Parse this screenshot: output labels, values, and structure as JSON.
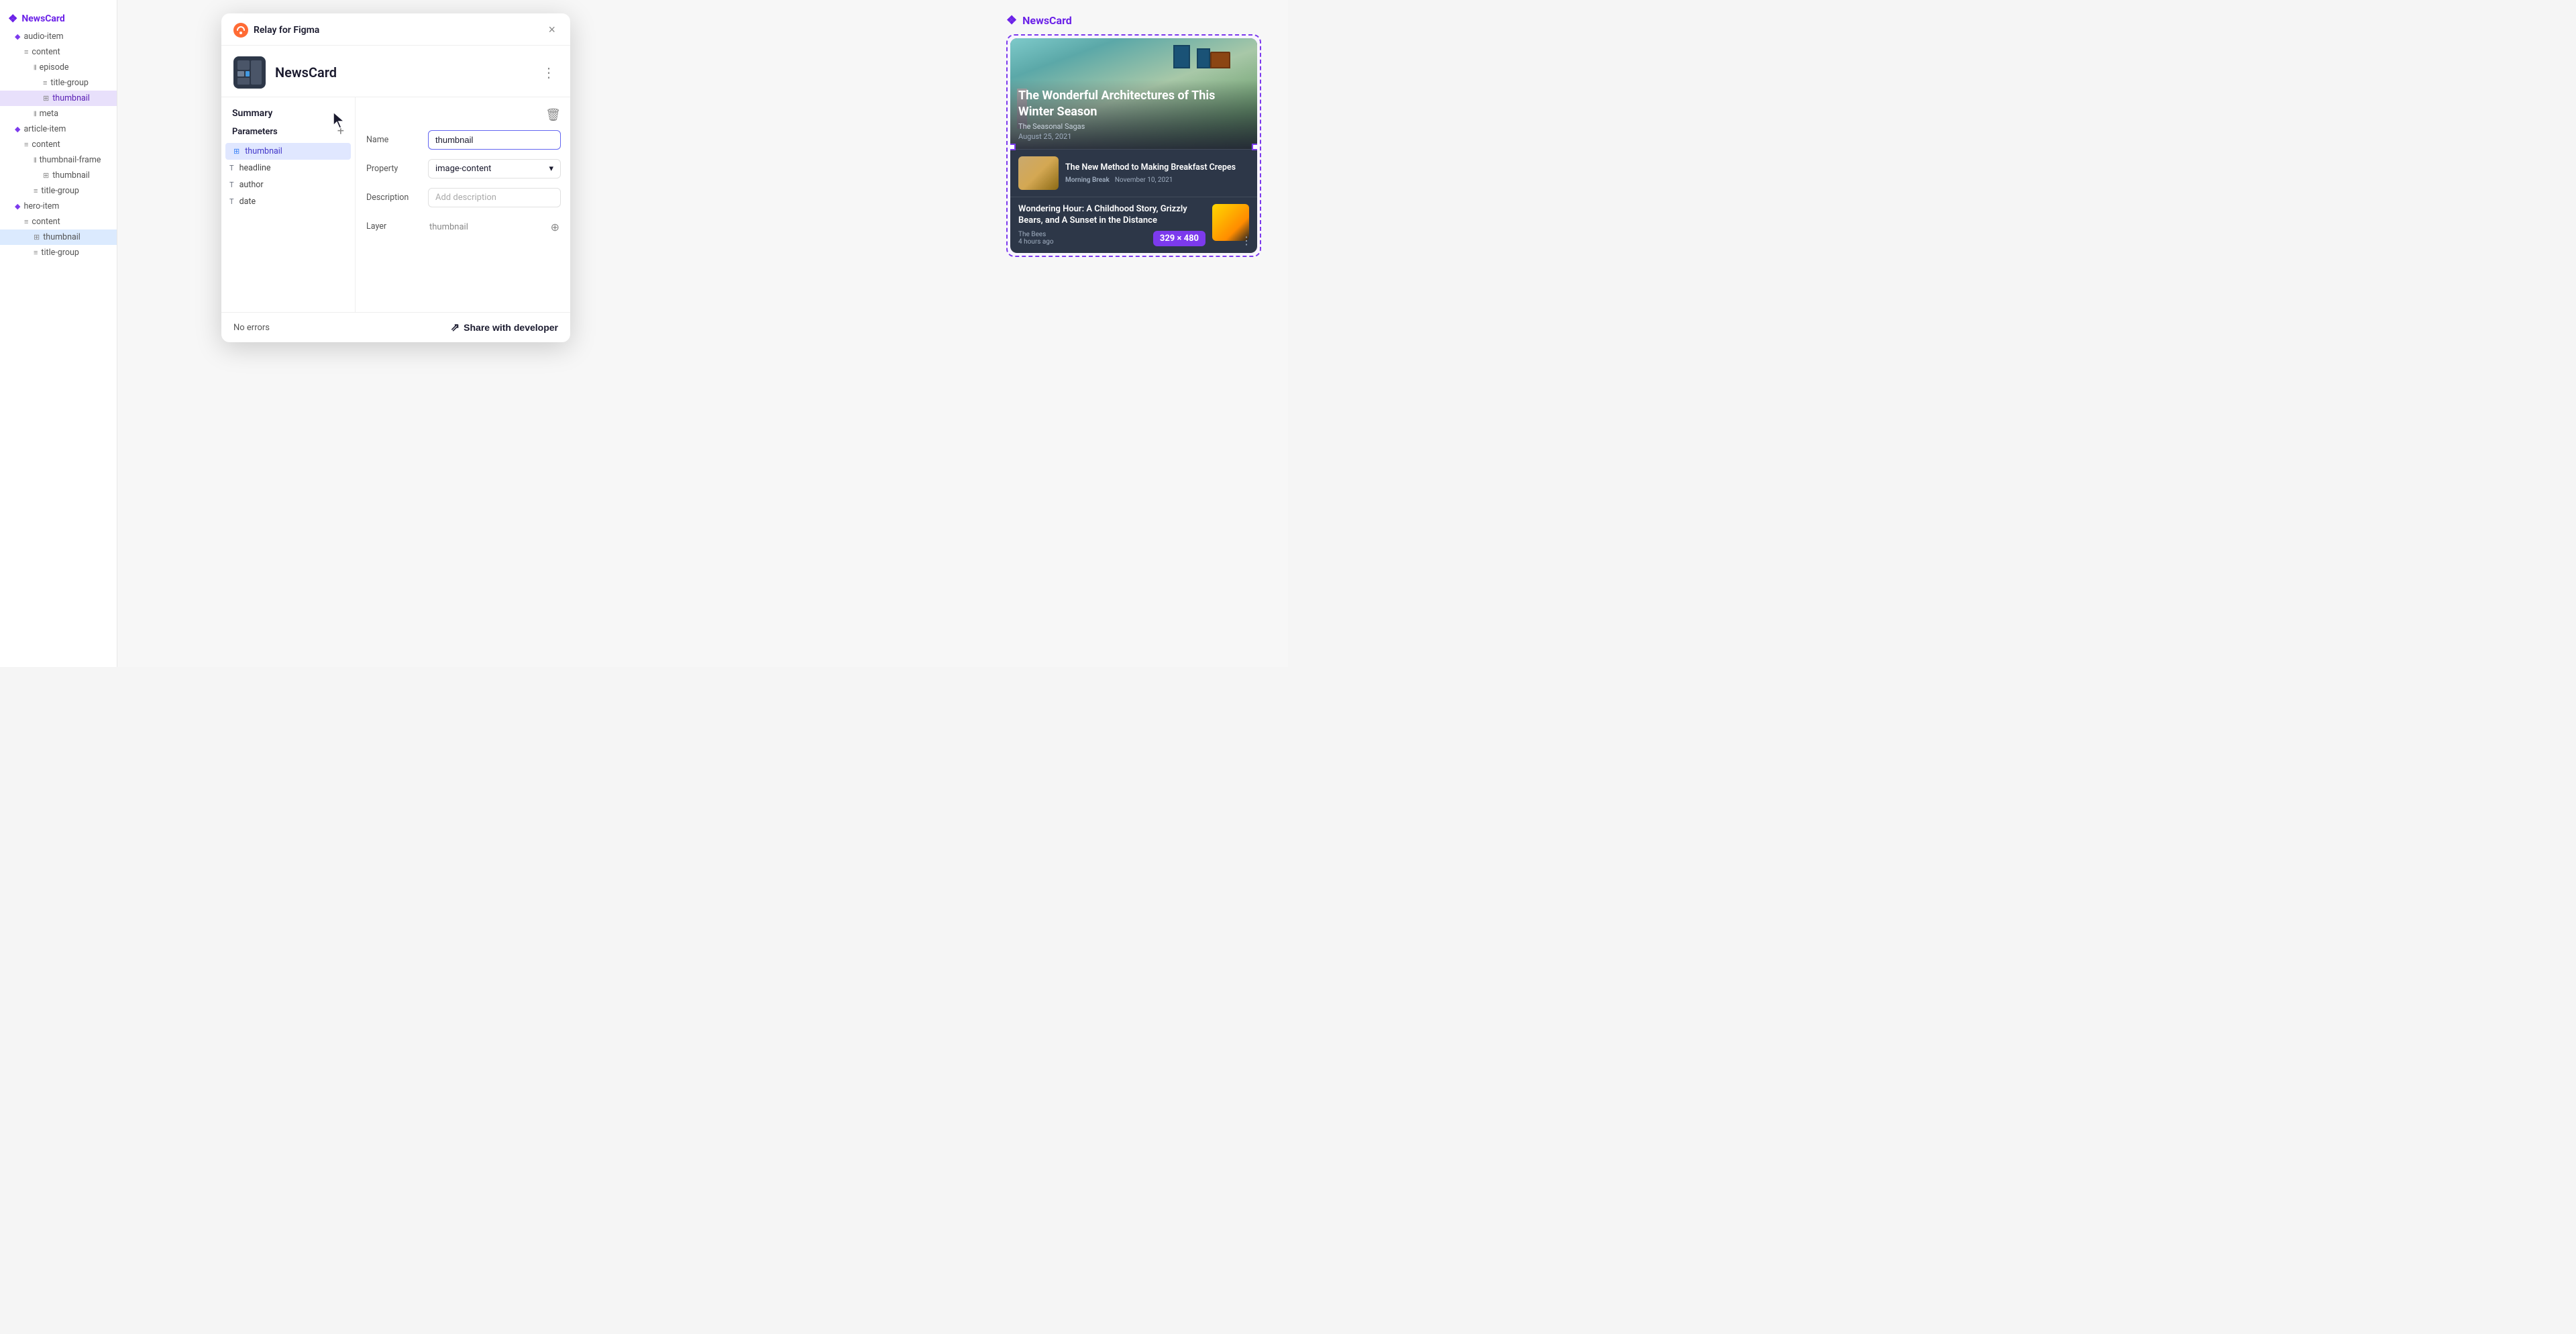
{
  "app": {
    "title": "NewsCard"
  },
  "sidebar": {
    "root_label": "NewsCard",
    "items": [
      {
        "id": "audio-item",
        "label": "audio-item",
        "indent": 1,
        "icon": "diamond",
        "color": "purple"
      },
      {
        "id": "content",
        "label": "content",
        "indent": 2,
        "icon": "lines"
      },
      {
        "id": "episode",
        "label": "episode",
        "indent": 3,
        "icon": "bars"
      },
      {
        "id": "title-group",
        "label": "title-group",
        "indent": 4,
        "icon": "lines"
      },
      {
        "id": "thumbnail-1",
        "label": "thumbnail",
        "indent": 4,
        "icon": "img",
        "selected": true
      },
      {
        "id": "meta",
        "label": "meta",
        "indent": 3,
        "icon": "bars"
      },
      {
        "id": "article-item",
        "label": "article-item",
        "indent": 1,
        "icon": "diamond",
        "color": "purple"
      },
      {
        "id": "content-2",
        "label": "content",
        "indent": 2,
        "icon": "lines"
      },
      {
        "id": "thumbnail-frame",
        "label": "thumbnail-frame",
        "indent": 3,
        "icon": "bars"
      },
      {
        "id": "thumbnail-2",
        "label": "thumbnail",
        "indent": 4,
        "icon": "img"
      },
      {
        "id": "title-group-2",
        "label": "title-group",
        "indent": 3,
        "icon": "lines"
      },
      {
        "id": "hero-item",
        "label": "hero-item",
        "indent": 1,
        "icon": "diamond",
        "color": "purple"
      },
      {
        "id": "content-3",
        "label": "content",
        "indent": 2,
        "icon": "lines"
      },
      {
        "id": "thumbnail-3",
        "label": "thumbnail",
        "indent": 3,
        "icon": "img",
        "highlighted": true
      },
      {
        "id": "title-group-3",
        "label": "title-group",
        "indent": 3,
        "icon": "lines"
      }
    ]
  },
  "relay": {
    "app_name": "Relay for Figma",
    "close_label": "×",
    "more_label": "⋮"
  },
  "modal": {
    "component_name": "NewsCard",
    "summary_label": "Summary",
    "params_label": "Parameters",
    "add_param_label": "+",
    "params": [
      {
        "id": "thumbnail",
        "label": "thumbnail",
        "type": "img",
        "selected": true
      },
      {
        "id": "headline",
        "label": "headline",
        "type": "text"
      },
      {
        "id": "author",
        "label": "author",
        "type": "text"
      },
      {
        "id": "date",
        "label": "date",
        "type": "text"
      }
    ],
    "detail": {
      "name_label": "Name",
      "name_value": "thumbnail",
      "property_label": "Property",
      "property_value": "image-content",
      "description_label": "Description",
      "description_placeholder": "Add description",
      "layer_label": "Layer",
      "layer_value": "thumbnail"
    },
    "delete_icon": "🗑",
    "target_icon": "⊕",
    "no_errors": "No errors",
    "share_label": "Share with developer",
    "share_icon": "↗"
  },
  "preview": {
    "title": "NewsCard",
    "hero": {
      "title": "The Wonderful Architectures of This Winter Season",
      "source": "The Seasonal Sagas",
      "date": "August 25, 2021"
    },
    "articles": [
      {
        "title": "The New Method to Making Breakfast Crepes",
        "source": "Morning Break",
        "date": "November 10, 2021"
      },
      {
        "title": "Wondering Hour: A Childhood Story, Grizzly Bears, and A Sunset in the Distance",
        "source": "The Bees",
        "time": "4 hours ago",
        "size": "329 × 480"
      }
    ]
  }
}
